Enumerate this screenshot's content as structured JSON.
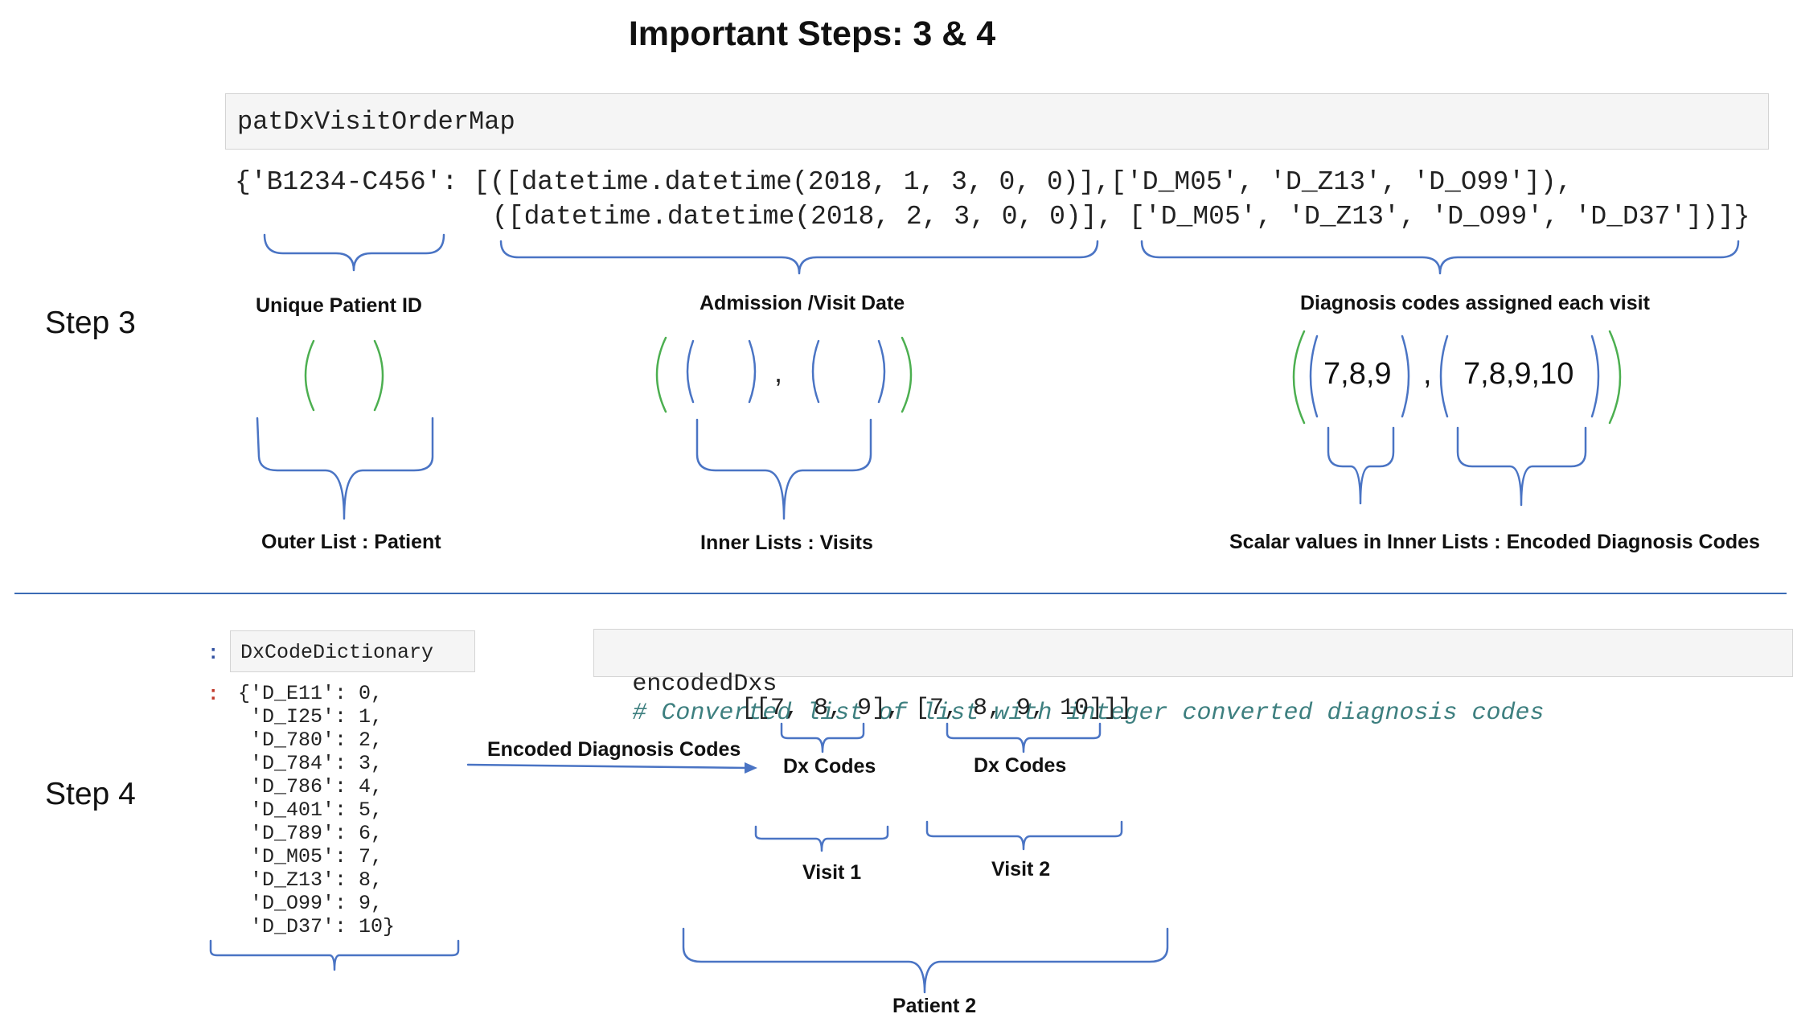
{
  "title": "Important Steps: 3 & 4",
  "step3": {
    "label": "Step 3",
    "cell_var": "patDxVisitOrderMap",
    "output_line1": "{'B1234-C456': [([datetime.datetime(2018, 1, 3, 0, 0)],['D_M05', 'D_Z13', 'D_O99']),",
    "output_line2": "([datetime.datetime(2018, 2, 3, 0, 0)], ['D_M05', 'D_Z13', 'D_O99', 'D_D37'])]}",
    "labels": {
      "patient_id": "Unique Patient ID",
      "visit_date": "Admission /Visit Date",
      "diagnosis": "Diagnosis codes assigned each visit",
      "outer_list": "Outer List : Patient",
      "inner_lists": "Inner Lists : Visits",
      "scalar_values": "Scalar values in  Inner Lists : Encoded Diagnosis Codes"
    },
    "visit_separator": ",",
    "codes_visit1": "7,8,9",
    "codes_separator": ",",
    "codes_visit2": "7,8,9,10"
  },
  "step4": {
    "label": "Step 4",
    "in_prompt": ":",
    "out_prompt": ":",
    "dict_var": "DxCodeDictionary",
    "dict_lines": [
      "{'D_E11': 0,",
      " 'D_I25': 1,",
      " 'D_780': 2,",
      " 'D_784': 3,",
      " 'D_786': 4,",
      " 'D_401': 5,",
      " 'D_789': 6,",
      " 'D_M05': 7,",
      " 'D_Z13': 8,",
      " 'D_O99': 9,",
      " 'D_D37': 10}"
    ],
    "encoded_var": "encodedDxs",
    "encoded_comment": "# Converted list of list with integer converted diagnosis codes",
    "encoded_output": "[[7, 8, 9], [7, 8, 9, 10]]]",
    "arrow_label": "Encoded Diagnosis Codes",
    "dx_codes_1": "Dx Codes",
    "dx_codes_2": "Dx Codes",
    "visit1": "Visit 1",
    "visit2": "Visit 2",
    "patient": "Patient 2"
  },
  "colors": {
    "bracket_blue": "#4a74c4",
    "bracket_green": "#4caf50",
    "divider": "#3b6bb5",
    "prompt_blue": "#3050a0",
    "prompt_red": "#c0392b",
    "comment_teal": "#3d7f7f"
  }
}
